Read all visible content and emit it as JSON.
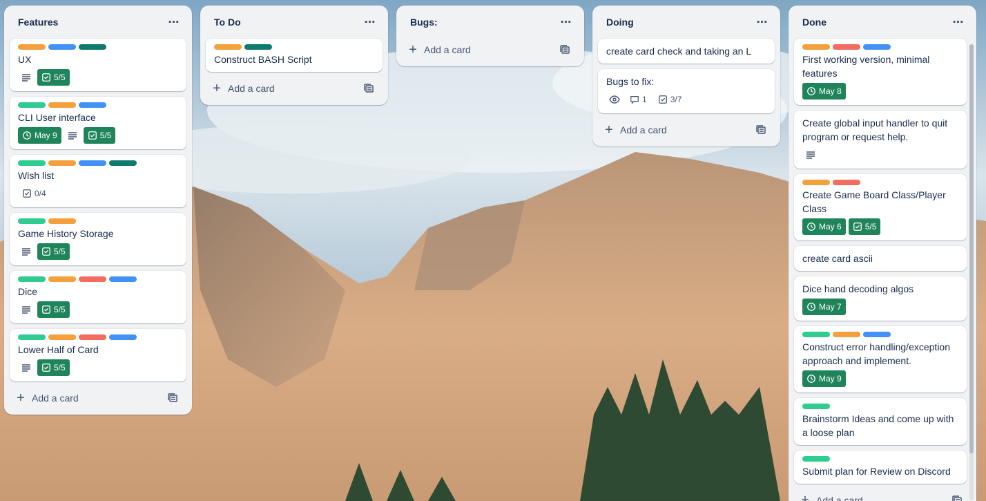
{
  "colors": {
    "orange": "#f5a03d",
    "blue": "#4291f5",
    "darkteal": "#0e7a6e",
    "green": "#2ecc8f",
    "red": "#f46b60",
    "badge_green": "#1f845a"
  },
  "icons": {
    "menu": "ellipsis-icon",
    "description": "description-icon",
    "checklist": "checklist-icon",
    "clock": "clock-icon",
    "watch": "eye-icon",
    "comment": "comment-icon",
    "plus": "plus-icon",
    "template": "template-icon"
  },
  "lists": [
    {
      "title": "Features",
      "add_label": "Add a card",
      "cards": [
        {
          "labels": [
            "orange",
            "blue",
            "darkteal"
          ],
          "title": "UX",
          "badges": {
            "description": true,
            "checklist": "5/5",
            "checklist_complete": true
          }
        },
        {
          "labels": [
            "green",
            "orange",
            "blue"
          ],
          "title": "CLI User interface",
          "badges": {
            "due": "May 9",
            "description": true,
            "checklist": "5/5",
            "checklist_complete": true
          }
        },
        {
          "labels": [
            "green",
            "orange",
            "blue",
            "darkteal"
          ],
          "title": "Wish list",
          "badges": {
            "checklist": "0/4",
            "checklist_complete": false
          }
        },
        {
          "labels": [
            "green",
            "orange"
          ],
          "title": "Game History Storage",
          "badges": {
            "description": true,
            "checklist": "5/5",
            "checklist_complete": true
          }
        },
        {
          "labels": [
            "green",
            "orange",
            "red",
            "blue"
          ],
          "title": "Dice",
          "badges": {
            "description": true,
            "checklist": "5/5",
            "checklist_complete": true
          }
        },
        {
          "labels": [
            "green",
            "orange",
            "red",
            "blue"
          ],
          "title": "Lower Half of Card",
          "badges": {
            "description": true,
            "checklist": "5/5",
            "checklist_complete": true
          }
        }
      ]
    },
    {
      "title": "To Do",
      "add_label": "Add a card",
      "cards": [
        {
          "labels": [
            "orange",
            "darkteal"
          ],
          "title": "Construct BASH Script"
        }
      ]
    },
    {
      "title": "Bugs:",
      "add_label": "Add a card",
      "cards": []
    },
    {
      "title": "Doing",
      "add_label": "Add a card",
      "cards": [
        {
          "title": "create card check and taking an L"
        },
        {
          "title": "Bugs to fix:",
          "badges": {
            "watch": true,
            "comments": "1",
            "checklist": "3/7",
            "checklist_complete": false
          }
        }
      ]
    },
    {
      "title": "Done",
      "add_label": "Add a card",
      "cards": [
        {
          "labels": [
            "orange",
            "red",
            "blue"
          ],
          "title": "First working version, minimal features",
          "badges": {
            "due": "May 8"
          }
        },
        {
          "title": "Create global input handler to quit program or request help.",
          "badges": {
            "description": true
          }
        },
        {
          "labels": [
            "orange",
            "red"
          ],
          "title": "Create Game Board Class/Player Class",
          "badges": {
            "due": "May 6",
            "checklist": "5/5",
            "checklist_complete": true
          }
        },
        {
          "title": "create card ascii"
        },
        {
          "title": "Dice hand decoding algos",
          "badges": {
            "due": "May 7"
          }
        },
        {
          "labels": [
            "green",
            "orange",
            "blue"
          ],
          "title": "Construct error handling/exception approach and implement.",
          "badges": {
            "due": "May 9"
          }
        },
        {
          "labels": [
            "green"
          ],
          "title": "Brainstorm Ideas and come up with a loose plan"
        },
        {
          "labels": [
            "green"
          ],
          "title": "Submit plan for Review on Discord"
        }
      ]
    }
  ]
}
